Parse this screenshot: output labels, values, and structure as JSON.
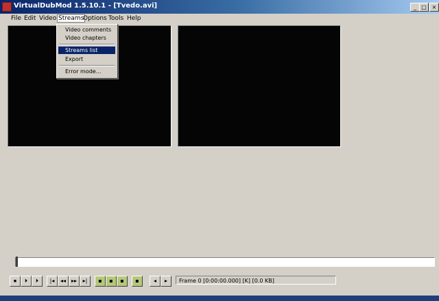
{
  "window": {
    "title": "VirtualDubMod 1.5.10.1 - [Tvedo.avi]"
  },
  "title_buttons": {
    "minimize": "_",
    "maximize": "□",
    "close": "×"
  },
  "menu": [
    "File",
    "Edit",
    "Video",
    "Streams",
    "Options",
    "Tools",
    "Help"
  ],
  "streams_menu": {
    "items": [
      "Video comments",
      "Video chapters",
      "Streams list",
      "Export",
      "Error mode..."
    ],
    "selected": "Streams list"
  },
  "toolbar": {
    "buttons": [
      "⏹",
      "⏵",
      "⏵",
      "|◂",
      "◂◂",
      "▸▸",
      "▸|",
      "▪",
      "▪",
      "▪",
      "▪",
      "◂",
      "▸"
    ]
  },
  "status": {
    "text": "Frame 0 [0:00:00.000] [K] [0.0 KB]"
  }
}
